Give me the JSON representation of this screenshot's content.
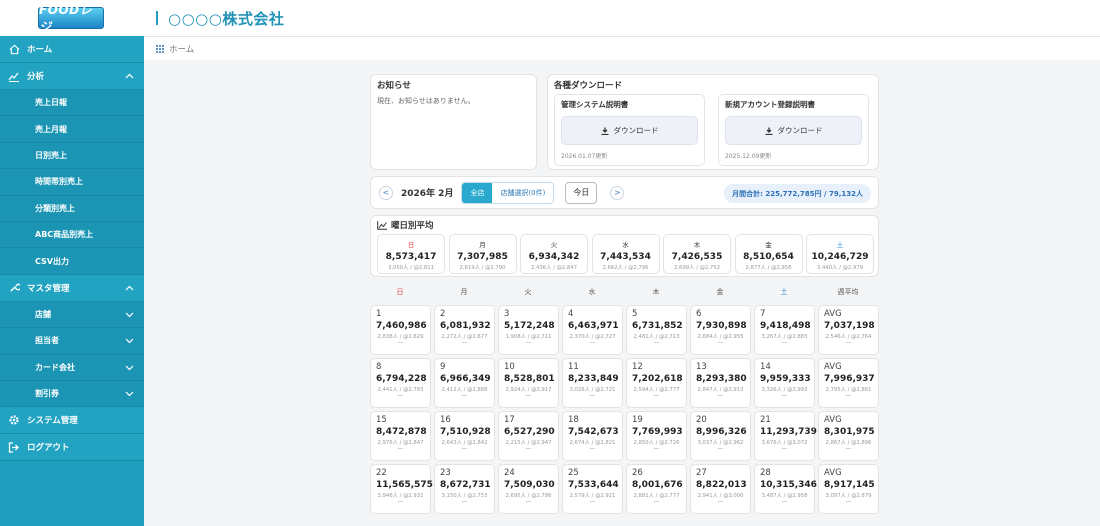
{
  "header": {
    "logo_text": "FOODレジ",
    "company": "○○○○株式会社"
  },
  "breadcrumb": {
    "label": "ホーム"
  },
  "sidebar": {
    "home": "ホーム",
    "analysis": "分析",
    "analysis_items": [
      "売上日報",
      "売上月報",
      "日別売上",
      "時間帯別売上",
      "分類別売上",
      "ABC商品別売上",
      "CSV出力"
    ],
    "master": "マスタ管理",
    "master_items": [
      "店舗",
      "担当者",
      "カード会社",
      "割引券"
    ],
    "system": "システム管理",
    "logout": "ログアウト"
  },
  "notice": {
    "title": "お知らせ",
    "body": "現在、お知らせはありません。"
  },
  "downloads": {
    "title": "各種ダウンロード",
    "items": [
      {
        "title": "管理システム説明書",
        "button": "ダウンロード",
        "date": "2026.01.07更新"
      },
      {
        "title": "新規アカウント登録説明書",
        "button": "ダウンロード",
        "date": "2025.12.09更新"
      }
    ]
  },
  "controls": {
    "prev": "<",
    "next": ">",
    "month": "2026年 2月",
    "all_label": "全店",
    "store_select": "店舗選択(0件)",
    "today": "今日",
    "monthly_total": "月間合計: 225,772,785円 / 79,132人"
  },
  "weekday_avg": {
    "title": "曜日別平均",
    "items": [
      {
        "day": "日",
        "value": "8,573,417",
        "sub": "3,050人 / @2,811",
        "color": "red"
      },
      {
        "day": "月",
        "value": "7,307,985",
        "sub": "2,619人 / @2,790",
        "color": ""
      },
      {
        "day": "火",
        "value": "6,934,342",
        "sub": "2,436人 / @2,847",
        "color": ""
      },
      {
        "day": "水",
        "value": "7,443,534",
        "sub": "2,662人 / @2,796",
        "color": ""
      },
      {
        "day": "木",
        "value": "7,426,535",
        "sub": "2,699人 / @2,752",
        "color": ""
      },
      {
        "day": "金",
        "value": "8,510,654",
        "sub": "2,877人 / @2,958",
        "color": ""
      },
      {
        "day": "土",
        "value": "10,246,729",
        "sub": "3,440人 / @2,979",
        "color": "blue"
      }
    ]
  },
  "calendar": {
    "headers": [
      "日",
      "月",
      "火",
      "水",
      "木",
      "金",
      "土",
      "週平均"
    ],
    "weeks": [
      [
        {
          "d": "1",
          "v": "7,460,986",
          "s": "2,838人 / @2,629"
        },
        {
          "d": "2",
          "v": "6,081,932",
          "s": "2,272人 / @2,677"
        },
        {
          "d": "3",
          "v": "5,172,248",
          "s": "1,908人 / @2,711"
        },
        {
          "d": "4",
          "v": "6,463,971",
          "s": "2,370人 / @2,727"
        },
        {
          "d": "5",
          "v": "6,731,852",
          "s": "2,481人 / @2,713"
        },
        {
          "d": "6",
          "v": "7,930,898",
          "s": "2,684人 / @2,955"
        },
        {
          "d": "7",
          "v": "9,418,498",
          "s": "3,267人 / @2,883"
        },
        {
          "d": "AVG",
          "v": "7,037,198",
          "s": "2,546人 / @2,764"
        }
      ],
      [
        {
          "d": "8",
          "v": "6,794,228",
          "s": "2,441人 / @2,783"
        },
        {
          "d": "9",
          "v": "6,966,349",
          "s": "2,412人 / @2,888"
        },
        {
          "d": "10",
          "v": "8,528,801",
          "s": "2,924人 / @2,917"
        },
        {
          "d": "11",
          "v": "8,233,849",
          "s": "3,026人 / @2,721"
        },
        {
          "d": "12",
          "v": "7,202,618",
          "s": "2,594人 / @2,777"
        },
        {
          "d": "13",
          "v": "8,293,380",
          "s": "2,847人 / @2,913"
        },
        {
          "d": "14",
          "v": "9,959,333",
          "s": "3,326人 / @2,993"
        },
        {
          "d": "AVG",
          "v": "7,996,937",
          "s": "2,795人 / @2,861"
        }
      ],
      [
        {
          "d": "15",
          "v": "8,472,878",
          "s": "2,976人 / @2,847"
        },
        {
          "d": "16",
          "v": "7,510,928",
          "s": "2,643人 / @2,842"
        },
        {
          "d": "17",
          "v": "6,527,290",
          "s": "2,215人 / @2,947"
        },
        {
          "d": "18",
          "v": "7,542,673",
          "s": "2,674人 / @2,821"
        },
        {
          "d": "19",
          "v": "7,769,993",
          "s": "2,850人 / @2,726"
        },
        {
          "d": "20",
          "v": "8,996,326",
          "s": "3,037人 / @2,962"
        },
        {
          "d": "21",
          "v": "11,293,739",
          "s": "3,676人 / @3,072"
        },
        {
          "d": "AVG",
          "v": "8,301,975",
          "s": "2,867人 / @2,896"
        }
      ],
      [
        {
          "d": "22",
          "v": "11,565,575",
          "s": "3,946人 / @2,931"
        },
        {
          "d": "23",
          "v": "8,672,731",
          "s": "3,150人 / @2,753"
        },
        {
          "d": "24",
          "v": "7,509,030",
          "s": "2,695人 / @2,786"
        },
        {
          "d": "25",
          "v": "7,533,644",
          "s": "2,579人 / @2,921"
        },
        {
          "d": "26",
          "v": "8,001,676",
          "s": "2,881人 / @2,777"
        },
        {
          "d": "27",
          "v": "8,822,013",
          "s": "2,941人 / @3,000"
        },
        {
          "d": "28",
          "v": "10,315,346",
          "s": "3,487人 / @2,958"
        },
        {
          "d": "AVG",
          "v": "8,917,145",
          "s": "3,097人 / @2,879"
        }
      ]
    ],
    "dash": "—"
  },
  "colors": {
    "accent": "#1f9fbd",
    "sunday": "#e24a4a",
    "saturday": "#2b8fd8"
  }
}
